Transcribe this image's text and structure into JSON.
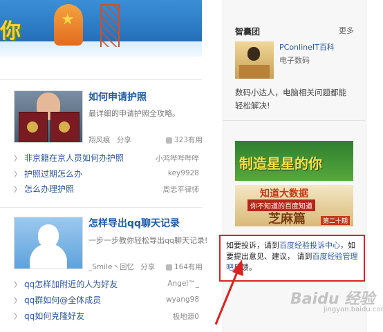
{
  "banner": {
    "word": "你"
  },
  "cards": [
    {
      "title": "如何申请护照",
      "desc": "最详细的申请护照全攻略。",
      "author": "翔风痕",
      "share": "分享",
      "useful": "323有用",
      "related": [
        {
          "title": "非京籍在京人员如何办护照",
          "user": "小鸿哔哔哔哔"
        },
        {
          "title": "护照过期怎么办",
          "user": "key9928"
        },
        {
          "title": "怎么办理护照",
          "user": "周忠平律师"
        }
      ]
    },
    {
      "title": "怎样导出qq聊天记录",
      "desc": "一步一步教你轻松导出qq聊天记录!",
      "author": "_Smile丶回忆",
      "share": "分享",
      "useful": "164有用",
      "related": [
        {
          "title": "qq怎样加附近的人为好友",
          "user": "Angel™_"
        },
        {
          "title": "qq群如何@全体成员",
          "user": "wyang98"
        },
        {
          "title": "qq如何克隆好友",
          "user": "极地源0"
        }
      ]
    }
  ],
  "team": {
    "title": "智囊团",
    "more": "更多",
    "name": "PConlineIT百科",
    "category": "电子数码",
    "desc": "数码小达人，电脑相关问题都能轻松解决!"
  },
  "ads": {
    "ad1": "制造星星的你",
    "ad2": {
      "line1": "知道大数据",
      "line2": "你不知道的百度知道",
      "line3": "芝麻篇",
      "line4": "第二十期"
    }
  },
  "report": {
    "p1": "如要投诉，请到",
    "link1": "百度经验投诉中心",
    "p2": "，如要提出意见、建议， 请到",
    "link2": "百度经验管理吧",
    "p3": "反馈。"
  },
  "watermark": {
    "main": "Baidu 经验",
    "sub": "jingyan.baidu.com"
  },
  "colors": {
    "link": "#2a55a0",
    "highlight_border": "#e02020",
    "arrow": "#e02020"
  }
}
